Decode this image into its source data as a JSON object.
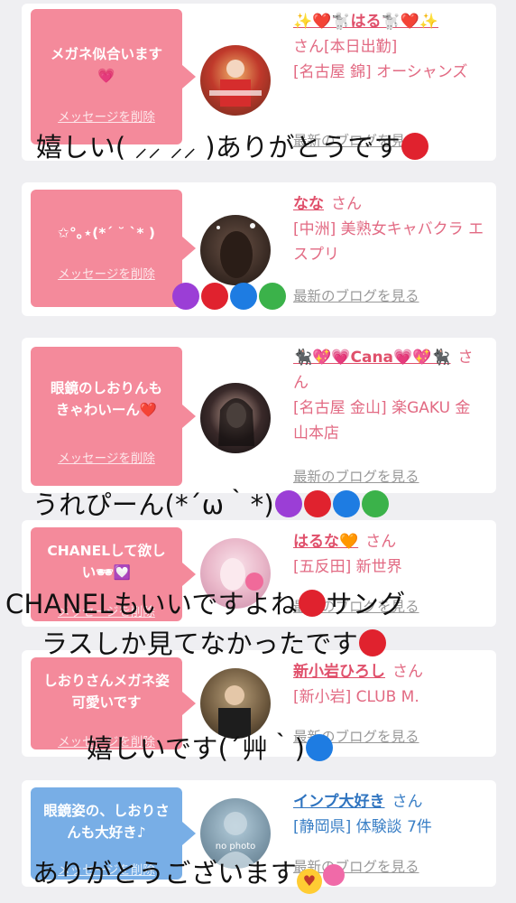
{
  "delete_label": "メッセージを削除",
  "blog_label": "最新のブログを見る",
  "san": "さん",
  "cards": [
    {
      "message": "メガネ似合います💗",
      "name": "✨❤️🐩はる🐩❤️✨",
      "line1": "[本日出勤]",
      "shop": "[名古屋 錦] オーシャンズ",
      "blog": "最新のブログを見る",
      "theme": "pink"
    },
    {
      "message": "✩°｡⋆(*´ ˘ `* )",
      "name": "なな",
      "shop": "[中洲] 美熟女キャバクラ エスプリ",
      "blog": "最新のブログを見る",
      "theme": "pink"
    },
    {
      "message": "眼鏡のしおりんもきゃわいーん❤️",
      "name": "🐈‍⬛💖💗Cana💗💖🐈‍⬛",
      "shop": "[名古屋 金山] 楽GAKU 金山本店",
      "blog": "最新のブログを見る",
      "theme": "pink"
    },
    {
      "message": "CHANELして欲しい🕶💟",
      "name": "はるな🧡",
      "shop": "[五反田] 新世界",
      "blog": "最新のブログを見る",
      "theme": "pink"
    },
    {
      "message": "しおりさんメガネ姿可愛いです",
      "name": "新小岩ひろし",
      "shop": "[新小岩] CLUB M.",
      "blog": "最新のブログを見る",
      "theme": "pink"
    },
    {
      "message": "眼鏡姿の、しおりさんも大好き♪",
      "name": "インプ大好き",
      "shop": "[静岡県] 体験談 7件",
      "blog": "最新のブログを見る",
      "avatar_text": "no photo",
      "theme": "blue"
    }
  ],
  "overlays": {
    "o1": "嬉しい( ⸝⸝ ⸝⸝ )ありがとうです",
    "o3": "うれぴーん(*´ω｀*)",
    "o4a": "CHANELもいいですよね",
    "o4a_tail": "サング",
    "o4b": "ラスしか見てなかったです",
    "o5": "嬉しいです(´艸｀)",
    "o6": "ありがとうございます"
  },
  "colors": {
    "pink_bubble": "#f48a9b",
    "blue_bubble": "#78aee6",
    "pink_text": "#e26a83",
    "blue_text": "#3a7fc6"
  }
}
